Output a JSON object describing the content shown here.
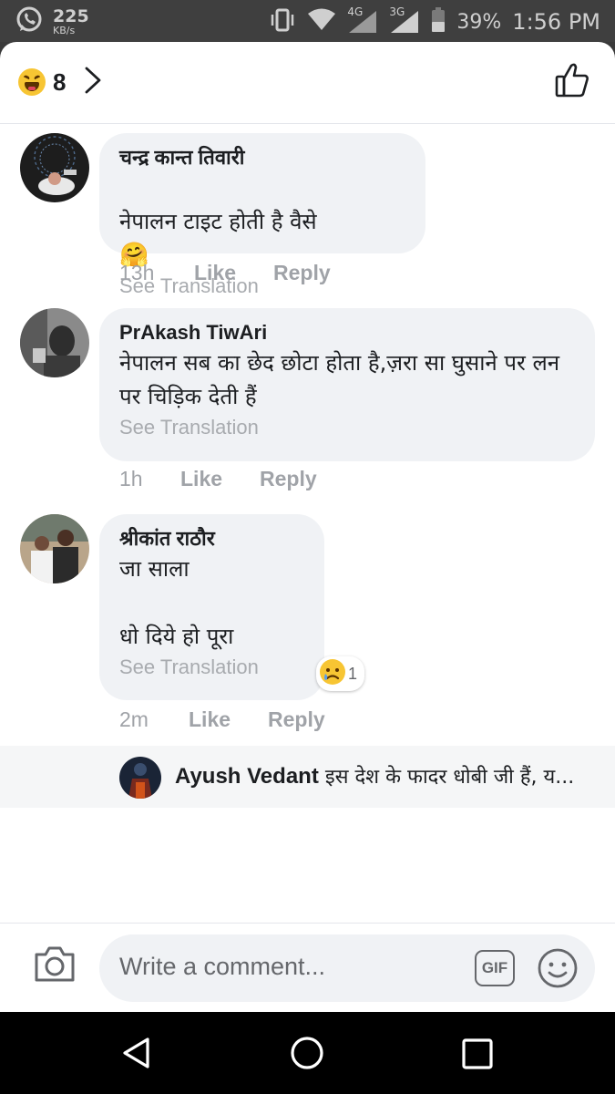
{
  "status_bar": {
    "speed_value": "225",
    "speed_unit": "KB/s",
    "network_4g": "4G",
    "network_3g": "3G",
    "battery_percent": "39%",
    "time": "1:56 PM"
  },
  "header": {
    "reaction_icon": "haha-emoji",
    "reaction_count": "8"
  },
  "comments": [
    {
      "author": "चन्द्र कान्त तिवारी",
      "text": "नेपालन टाइट होती है वैसे",
      "text_emoji": "🤗",
      "see_translation": "See Translation",
      "time": "13h",
      "like_label": "Like",
      "reply_label": "Reply"
    },
    {
      "author": "PrAkash TiwAri",
      "text": "नेपालन सब का छेद छोटा होता है,ज़रा सा घुसाने पर लन पर चिड़िक देती हैं",
      "see_translation": "See Translation",
      "time": "1h",
      "like_label": "Like",
      "reply_label": "Reply"
    },
    {
      "author": "श्रीकांत राठौर",
      "text": "जा साला\n\nधो दिये हो पूरा",
      "see_translation": "See Translation",
      "time": "2m",
      "like_label": "Like",
      "reply_label": "Reply",
      "reaction_icon": "sad-emoji",
      "reaction_count": "1"
    }
  ],
  "reply_preview": {
    "author": "Ayush Vedant",
    "text": "इस देश के फादर धोबी जी हैं, य..."
  },
  "composer": {
    "placeholder": "Write a comment...",
    "gif_label": "GIF"
  },
  "colors": {
    "bubble_bg": "#f0f2f5",
    "meta_gray": "#a0a3a8",
    "text_dark": "#1c1e21"
  }
}
